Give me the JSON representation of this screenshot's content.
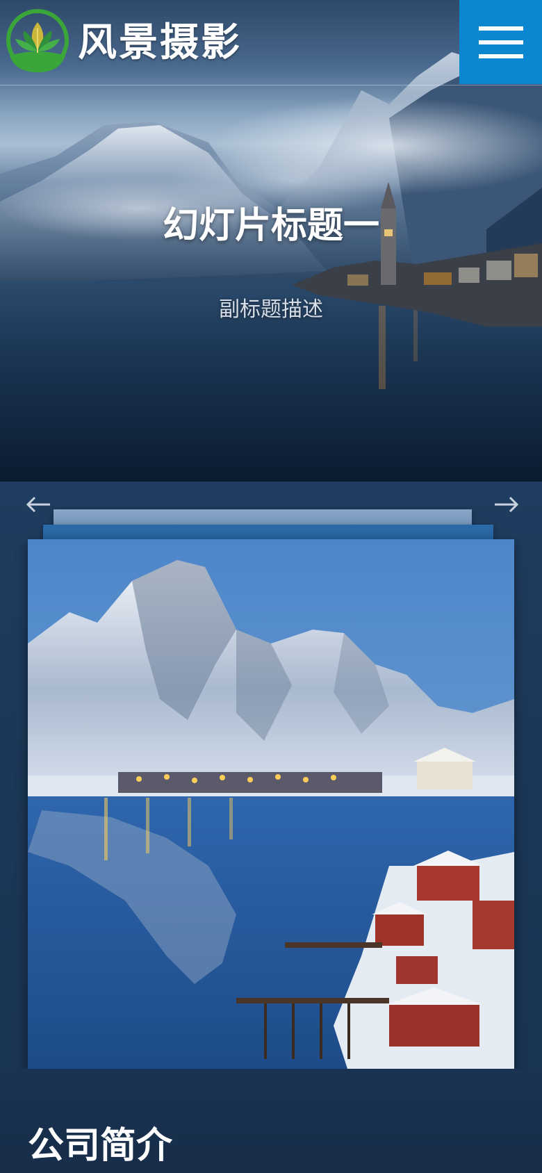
{
  "header": {
    "site_name": "风景摄影",
    "logo_icon": "lotus-leaf-logo",
    "menu_icon": "hamburger-menu-icon"
  },
  "hero": {
    "title": "幻灯片标题一",
    "subtitle": "副标题描述"
  },
  "gallery": {
    "prev_icon": "arrow-left-icon",
    "next_icon": "arrow-right-icon"
  },
  "about": {
    "title": "公司简介"
  },
  "colors": {
    "menu_button": "#0b86d1",
    "page_background": "#1b3350",
    "logo_green": "#3aa63a"
  }
}
